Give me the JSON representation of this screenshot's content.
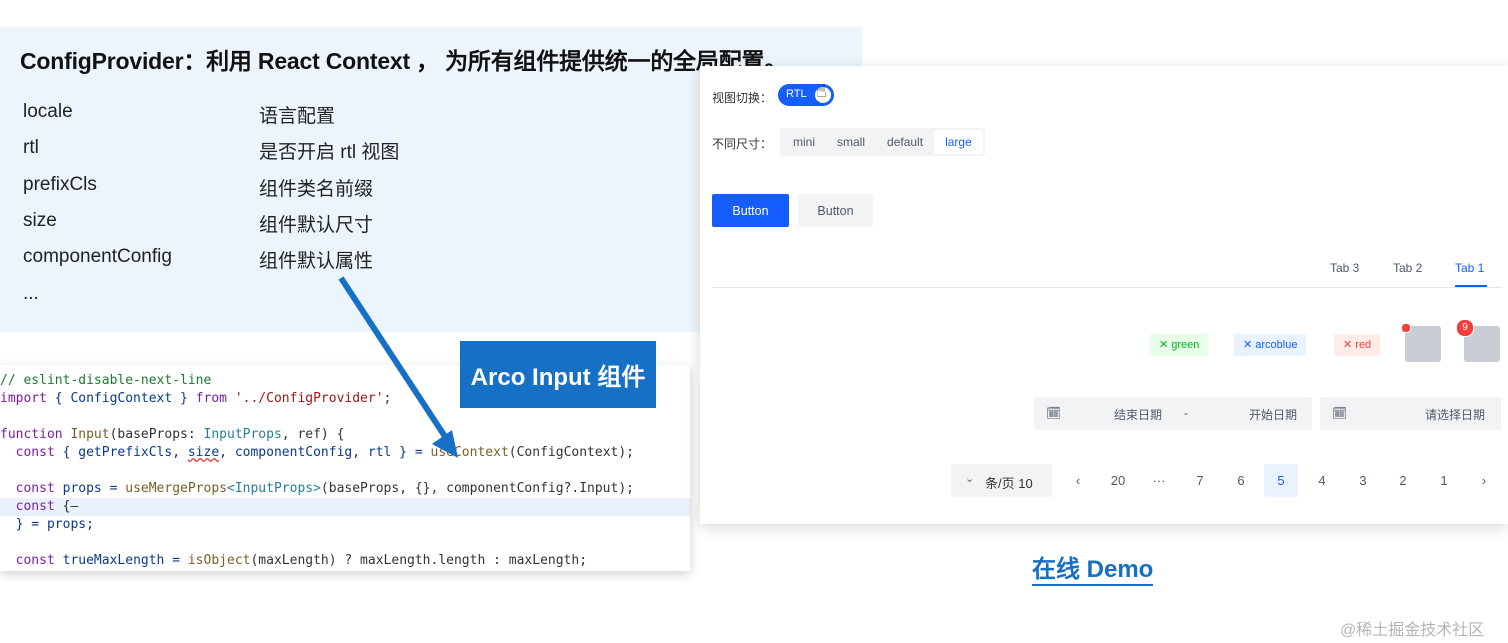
{
  "slide": {
    "title": "ConfigProvider：利用 React Context ， 为所有组件提供统一的全局配置。",
    "props": [
      {
        "name": "locale",
        "desc": "语言配置"
      },
      {
        "name": "rtl",
        "desc": "是否开启 rtl 视图"
      },
      {
        "name": "prefixCls",
        "desc": "组件类名前缀"
      },
      {
        "name": "size",
        "desc": "组件默认尺寸"
      },
      {
        "name": "componentConfig",
        "desc": "组件默认属性"
      },
      {
        "name": "...",
        "desc": ""
      }
    ],
    "callout": "Arco Input 组件",
    "demo_link": "在线 Demo",
    "watermark": "@稀土掘金技术社区"
  },
  "code": {
    "l1": "// eslint-disable-next-line",
    "l2a": "import",
    "l2b": " { ConfigContext } ",
    "l2c": "from",
    "l2d": " '../ConfigProvider'",
    "l2e": ";",
    "l4a": "function",
    "l4b": " Input",
    "l4c": "(baseProps: ",
    "l4d": "InputProps",
    "l4e": ", ref) {",
    "l5a": "  const",
    "l5b": " { getPrefixCls, ",
    "l5c": "size",
    "l5d": ", componentConfig, rtl } = ",
    "l5e": "useContext",
    "l5f": "(ConfigContext);",
    "l7a": "  const",
    "l7b": " props = ",
    "l7c": "useMergeProps",
    "l7d": "<InputProps>",
    "l7e": "(baseProps, {}, componentConfig?.Input);",
    "l8a": "  const",
    "l8b": " {—",
    "l9": "  } = props;",
    "l11a": "  const",
    "l11b": " trueMaxLength = ",
    "l11c": "isObject",
    "l11d": "(maxLength) ? maxLength.length : maxLength;"
  },
  "demo": {
    "view_switch_label": "视图切换：",
    "switch_text": "RTL",
    "size_label": "不同尺寸：",
    "sizes": [
      "mini",
      "small",
      "default",
      "large"
    ],
    "active_size": "large",
    "buttons": {
      "primary": "Button",
      "secondary": "Button"
    },
    "tabs": [
      "Tab 3",
      "Tab 2",
      "Tab 1"
    ],
    "active_tab": "Tab 1",
    "tags": [
      {
        "label": "green",
        "color": "#00b42a"
      },
      {
        "label": "arcoblue",
        "color": "#165dff"
      },
      {
        "label": "red",
        "color": "#f53f3f"
      }
    ],
    "badge_count": "9",
    "date_range": {
      "end": "结束日期",
      "sep": "-",
      "start": "开始日期"
    },
    "date_single": "请选择日期",
    "page_size": "条/页 10",
    "pages": [
      "20",
      "···",
      "7",
      "6",
      "5",
      "4",
      "3",
      "2",
      "1"
    ],
    "current_page": "5"
  },
  "colors": {
    "accent": "#165dff",
    "callout_bg": "#1670c6",
    "panel_bg": "#ecf5fd"
  }
}
